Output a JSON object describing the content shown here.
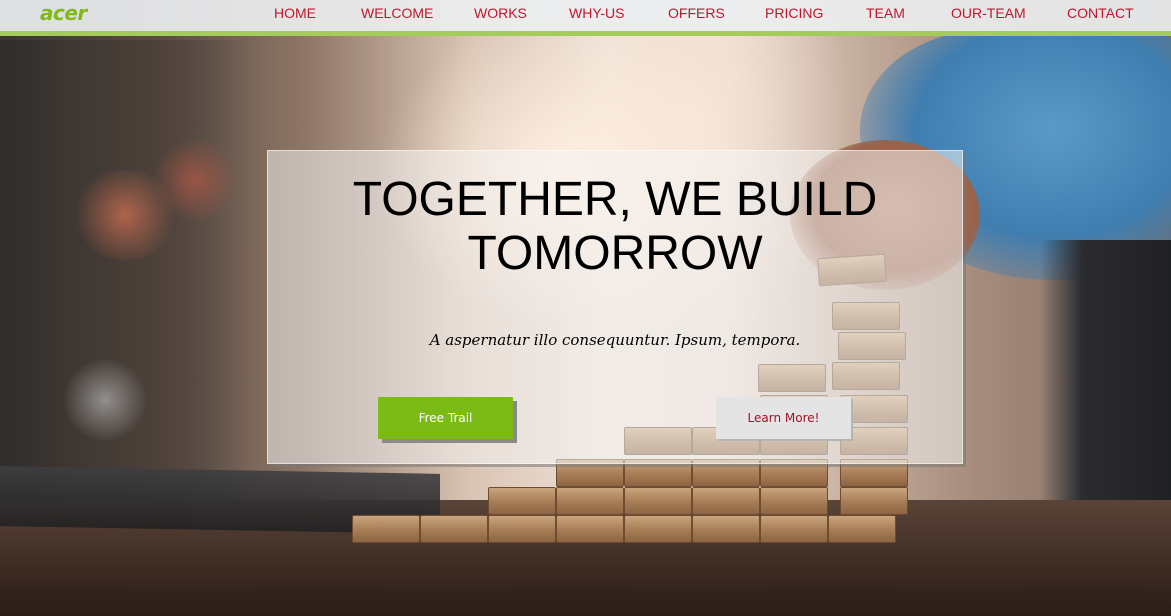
{
  "brand": {
    "logo_text": "acer",
    "accent_color": "#a3cc5a",
    "logo_color": "#83b81a",
    "link_color": "#c0172d"
  },
  "nav": {
    "items": [
      {
        "label": "HOME"
      },
      {
        "label": "WELCOME"
      },
      {
        "label": "WORKS"
      },
      {
        "label": "WHY-US"
      },
      {
        "label": "OFFERS"
      },
      {
        "label": "PRICING"
      },
      {
        "label": "TEAM"
      },
      {
        "label": "OUR-TEAM"
      },
      {
        "label": "CONTACT"
      }
    ]
  },
  "hero": {
    "title_line1": "TOGETHER, WE BUILD",
    "title_line2": "TOMORROW",
    "subtitle": "A aspernatur illo consequuntur. Ipsum, tempora.",
    "primary_button": "Free Trail",
    "secondary_button": "Learn More!",
    "primary_color": "#7cbb16",
    "background_image": "wooden-blocks-staircase-photo"
  }
}
